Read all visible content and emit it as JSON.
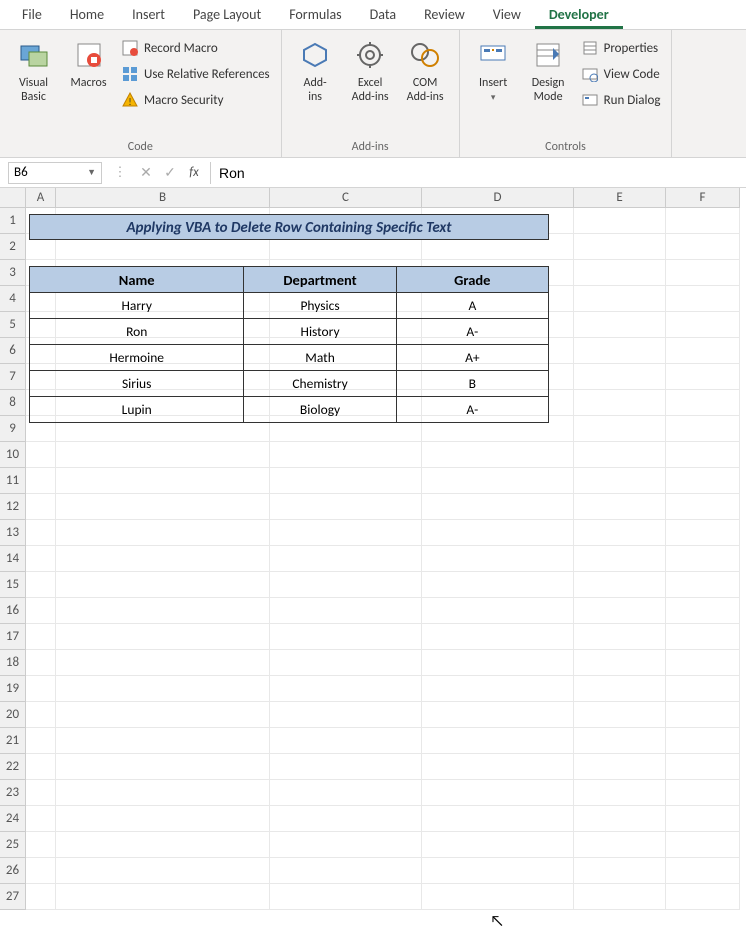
{
  "tabs": [
    "File",
    "Home",
    "Insert",
    "Page Layout",
    "Formulas",
    "Data",
    "Review",
    "View",
    "Developer"
  ],
  "active_tab": "Developer",
  "ribbon": {
    "code": {
      "visual_basic": "Visual\nBasic",
      "macros": "Macros",
      "record_macro": "Record Macro",
      "use_relative": "Use Relative References",
      "macro_security": "Macro Security",
      "group": "Code"
    },
    "addins": {
      "addins": "Add-\nins",
      "excel_addins": "Excel\nAdd-ins",
      "com_addins": "COM\nAdd-ins",
      "group": "Add-ins"
    },
    "controls": {
      "insert": "Insert",
      "design_mode": "Design\nMode",
      "properties": "Properties",
      "view_code": "View Code",
      "run_dialog": "Run Dialog",
      "group": "Controls"
    }
  },
  "name_box": "B6",
  "formula": "Ron",
  "columns": [
    "A",
    "B",
    "C",
    "D",
    "E",
    "F"
  ],
  "row_count": 27,
  "sheet_title": "Applying VBA to Delete Row Containing Specific Text",
  "headers": {
    "name": "Name",
    "dept": "Department",
    "grade": "Grade"
  },
  "rows": [
    {
      "name": "Harry",
      "dept": "Physics",
      "grade": "A"
    },
    {
      "name": "Ron",
      "dept": "History",
      "grade": "A-"
    },
    {
      "name": "Hermoine",
      "dept": "Math",
      "grade": "A+"
    },
    {
      "name": "Sirius",
      "dept": "Chemistry",
      "grade": "B"
    },
    {
      "name": "Lupin",
      "dept": "Biology",
      "grade": "A-"
    }
  ]
}
